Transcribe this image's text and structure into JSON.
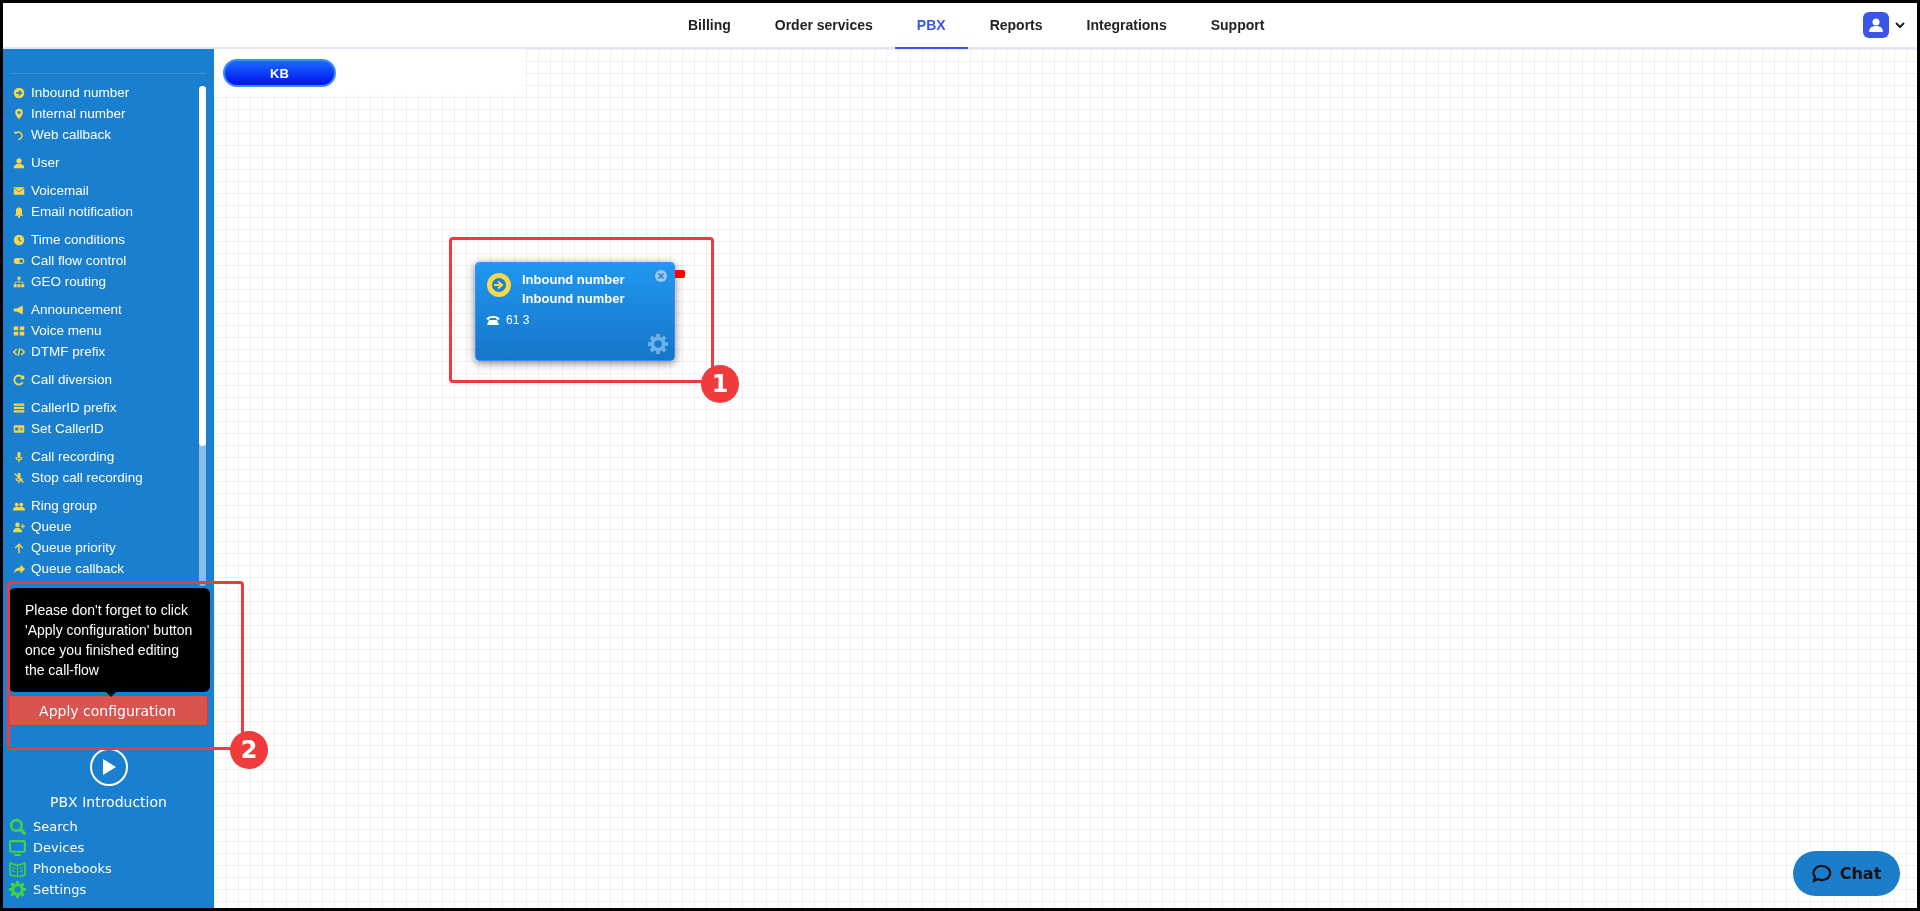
{
  "top_nav": {
    "tabs": [
      {
        "label": "Billing",
        "selected": false
      },
      {
        "label": "Order services",
        "selected": false
      },
      {
        "label": "PBX",
        "selected": true
      },
      {
        "label": "Reports",
        "selected": false
      },
      {
        "label": "Integrations",
        "selected": false
      },
      {
        "label": "Support",
        "selected": false
      }
    ]
  },
  "sidebar": {
    "groups": [
      {
        "items": [
          {
            "label": "Inbound number"
          },
          {
            "label": "Internal number"
          },
          {
            "label": "Web callback"
          }
        ]
      },
      {
        "items": [
          {
            "label": "User"
          }
        ]
      },
      {
        "items": [
          {
            "label": "Voicemail"
          },
          {
            "label": "Email notification"
          }
        ]
      },
      {
        "items": [
          {
            "label": "Time conditions"
          },
          {
            "label": "Call flow control"
          },
          {
            "label": "GEO routing"
          }
        ]
      },
      {
        "items": [
          {
            "label": "Announcement"
          },
          {
            "label": "Voice menu"
          },
          {
            "label": "DTMF prefix"
          }
        ]
      },
      {
        "items": [
          {
            "label": "Call diversion"
          }
        ]
      },
      {
        "items": [
          {
            "label": "CallerID prefix"
          },
          {
            "label": "Set CallerID"
          }
        ]
      },
      {
        "items": [
          {
            "label": "Call recording"
          },
          {
            "label": "Stop call recording"
          }
        ]
      },
      {
        "items": [
          {
            "label": "Ring group"
          },
          {
            "label": "Queue"
          },
          {
            "label": "Queue priority"
          },
          {
            "label": "Queue callback"
          }
        ]
      }
    ],
    "tooltip": "Please don't forget to click 'Apply configuration' button once you finished editing the call-flow",
    "apply_button": "Apply configuration",
    "intro_label": "PBX Introduction",
    "tools": [
      {
        "label": "Search"
      },
      {
        "label": "Devices"
      },
      {
        "label": "Phonebooks"
      },
      {
        "label": "Settings"
      }
    ]
  },
  "canvas": {
    "kb_button": "KB",
    "nodes": [
      {
        "title": "Inbound number",
        "subtitle": "Inbound number",
        "number": "61 3"
      }
    ]
  },
  "annotations": [
    {
      "number": "1"
    },
    {
      "number": "2"
    }
  ],
  "chat_button": "Chat"
}
